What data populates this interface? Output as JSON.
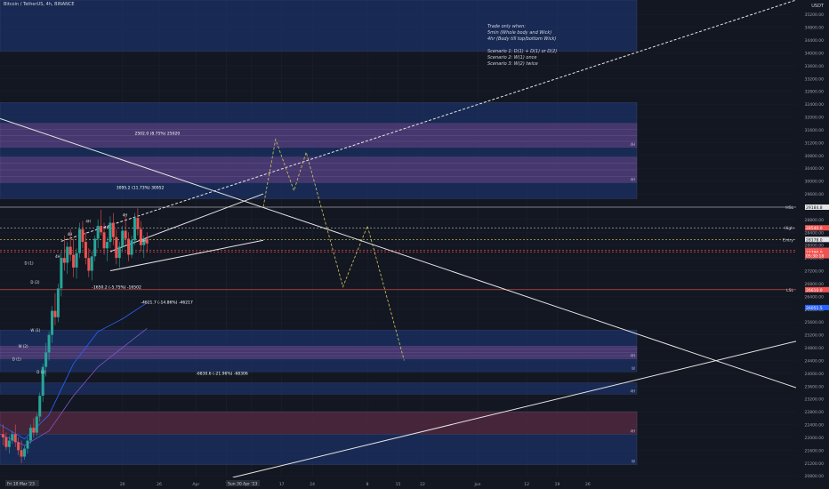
{
  "header": {
    "symbol_title": "Bitcoin / TetherUS, 4h, BINANCE"
  },
  "note": {
    "lines": [
      "Trade only when:",
      "5min (Whole body and Wick)",
      "4hr (Body till top/bottom Wick)",
      "",
      "Scenario 1: D(1) + D(1) or D(2)",
      "Scenario 2: W(1) once",
      "Scenario 3: W(2) twice"
    ]
  },
  "colors": {
    "background": "#131722",
    "zone_blue": "#1e3a7b",
    "zone_purple": "#5a3f7a",
    "zone_red": "#5a2330",
    "price_green": "#26a69a",
    "price_red": "#ef5350",
    "line_white": "#e6e6e6",
    "line_yellow": "#d4c85a",
    "ma_blue": "#2962ff"
  },
  "chart_data": {
    "type": "candlestick",
    "price_axis": {
      "currency": "USDT",
      "ticks": [
        35200,
        34800,
        34400,
        34000,
        33600,
        33200,
        32800,
        32400,
        32000,
        31600,
        31200,
        30800,
        30400,
        30000,
        29600,
        29200,
        28800,
        28400,
        28000,
        27600,
        27200,
        26800,
        26400,
        26000,
        25600,
        25200,
        24800,
        24400,
        24000,
        23600,
        23200,
        22800,
        22400,
        22000,
        21600,
        21200,
        20800
      ],
      "ylim": [
        20750,
        35650
      ]
    },
    "time_axis": {
      "labels": [
        {
          "x": 20,
          "label": "20"
        },
        {
          "x": 26,
          "label": "26"
        },
        {
          "x": 32,
          "label": "Apr"
        },
        {
          "x": 37,
          "label": "7"
        },
        {
          "x": 41,
          "label": "10"
        },
        {
          "x": 46,
          "label": "17"
        },
        {
          "x": 51,
          "label": "24"
        },
        {
          "x": 60,
          "label": "8"
        },
        {
          "x": 65,
          "label": "15"
        },
        {
          "x": 69,
          "label": "22"
        },
        {
          "x": 78,
          "label": "Jun"
        },
        {
          "x": 86,
          "label": "12"
        },
        {
          "x": 91,
          "label": "19"
        },
        {
          "x": 96,
          "label": "26"
        }
      ],
      "xlim": [
        0,
        130
      ],
      "range_badges": [
        "Fri 10 Mar '23",
        "Sun 30 Apr '23"
      ]
    },
    "zones": [
      {
        "x0": 0,
        "x1": 104,
        "y0": 34050,
        "y1": 35650,
        "kind": "blue",
        "label": ""
      },
      {
        "x0": 0,
        "x1": 104,
        "y0": 29450,
        "y1": 32450,
        "kind": "blue",
        "label": ""
      },
      {
        "x0": 0,
        "x1": 104,
        "y0": 31050,
        "y1": 31800,
        "kind": "purple",
        "label": "4H"
      },
      {
        "x0": 0,
        "x1": 104,
        "y0": 29950,
        "y1": 30750,
        "kind": "purple",
        "label": "4H"
      },
      {
        "x0": 0,
        "x1": 104,
        "y0": 24050,
        "y1": 25350,
        "kind": "blue",
        "label": "W"
      },
      {
        "x0": 0,
        "x1": 104,
        "y0": 24450,
        "y1": 24850,
        "kind": "purple",
        "label": "4H"
      },
      {
        "x0": 0,
        "x1": 104,
        "y0": 23350,
        "y1": 23700,
        "kind": "blue",
        "label": "4H"
      },
      {
        "x0": 0,
        "x1": 104,
        "y0": 21150,
        "y1": 22800,
        "kind": "blue",
        "label": "W"
      },
      {
        "x0": 0,
        "x1": 104,
        "y0": 22100,
        "y1": 22800,
        "kind": "red",
        "label": "4H"
      }
    ],
    "levels": [
      {
        "label": "HSL",
        "price": 29184.8,
        "price_text": "29184.8",
        "color": "#e6e6e6",
        "style": "solid"
      },
      {
        "label": "High",
        "price": 28540.0,
        "price_text": "28540.0",
        "color": "#e6e6e6",
        "style": "dashed"
      },
      {
        "label": "Entry",
        "price": 28178.0,
        "price_text": "28178.0",
        "color": "#d4c85a",
        "style": "dashed"
      },
      {
        "label": "",
        "price": 27838.0,
        "price_text": "27838.0",
        "color": "#ef5350",
        "style": "dashed"
      },
      {
        "label": "",
        "price": 27790.0,
        "price_text": "27790.0",
        "color": "#ef5350",
        "style": "dashed"
      },
      {
        "label": "LSL",
        "price": 26610.0,
        "price_text": "26610.0",
        "color": "#ef5350",
        "style": "solid"
      },
      {
        "label": "",
        "price": 26051.5,
        "price_text": "26051.5",
        "color": "#2962ff",
        "style": "none"
      }
    ],
    "countdown": "05:30:18",
    "measurements": [
      {
        "x": 22,
        "price": 31450,
        "text": "2502.0 (8.75%) 25020"
      },
      {
        "x": 19,
        "price": 29750,
        "text": "3095.2 (11.73%) 30952"
      },
      {
        "x": 15,
        "price": 26650,
        "text": "-1650.2 (-5.75%) -16502"
      },
      {
        "x": 23,
        "price": 26170,
        "text": "-4621.7 (-14.86%) -46217"
      },
      {
        "x": 32,
        "price": 23950,
        "text": "-6830.6 (-21.96%) -68306"
      }
    ],
    "pattern_labels": [
      "D (1)",
      "D (2)",
      "W (1)",
      "W (2)",
      "4H",
      "4H",
      "4H",
      "4H",
      "4H",
      "4H",
      "D (1)",
      "D (2)"
    ],
    "trendlines": [
      {
        "points": [
          [
            0,
            31950
          ],
          [
            130,
            23550
          ]
        ],
        "color": "#e6e6e6",
        "style": "solid"
      },
      {
        "points": [
          [
            38,
            20750
          ],
          [
            130,
            25000
          ]
        ],
        "color": "#e6e6e6",
        "style": "solid"
      },
      {
        "points": [
          [
            10,
            28120
          ],
          [
            130,
            35650
          ]
        ],
        "color": "#e6e6e6",
        "style": "dashed"
      },
      {
        "points": [
          [
            18,
            27800
          ],
          [
            43,
            29600
          ]
        ],
        "color": "#e6e6e6",
        "style": "solid"
      },
      {
        "points": [
          [
            18,
            27200
          ],
          [
            43,
            28150
          ]
        ],
        "color": "#e6e6e6",
        "style": "solid"
      }
    ],
    "projection_path": [
      [
        43,
        29200
      ],
      [
        45,
        31300
      ],
      [
        48,
        29700
      ],
      [
        50,
        30900
      ],
      [
        52,
        29500
      ],
      [
        56,
        26700
      ],
      [
        60,
        28600
      ],
      [
        66,
        24400
      ]
    ],
    "candles": [
      {
        "x": 0.5,
        "o": 22100,
        "h": 22400,
        "l": 21750,
        "c": 22000
      },
      {
        "x": 1,
        "o": 22000,
        "h": 22150,
        "l": 21600,
        "c": 21700
      },
      {
        "x": 1.5,
        "o": 21700,
        "h": 22050,
        "l": 21500,
        "c": 21900
      },
      {
        "x": 2,
        "o": 21900,
        "h": 22200,
        "l": 21800,
        "c": 22100
      },
      {
        "x": 2.5,
        "o": 22100,
        "h": 22400,
        "l": 21700,
        "c": 21850
      },
      {
        "x": 3,
        "o": 21850,
        "h": 22000,
        "l": 21450,
        "c": 21600
      },
      {
        "x": 3.5,
        "o": 21600,
        "h": 21900,
        "l": 21200,
        "c": 21400
      },
      {
        "x": 4,
        "o": 21400,
        "h": 21750,
        "l": 21300,
        "c": 21650
      },
      {
        "x": 4.5,
        "o": 21650,
        "h": 22000,
        "l": 21500,
        "c": 21900
      },
      {
        "x": 5,
        "o": 21900,
        "h": 22400,
        "l": 21800,
        "c": 22300
      },
      {
        "x": 5.5,
        "o": 22300,
        "h": 22600,
        "l": 22000,
        "c": 22150
      },
      {
        "x": 6,
        "o": 22150,
        "h": 22750,
        "l": 22050,
        "c": 22650
      },
      {
        "x": 6.5,
        "o": 22650,
        "h": 23400,
        "l": 22500,
        "c": 23300
      },
      {
        "x": 7,
        "o": 23300,
        "h": 24300,
        "l": 23100,
        "c": 24200
      },
      {
        "x": 7.5,
        "o": 24200,
        "h": 24950,
        "l": 23900,
        "c": 24650
      },
      {
        "x": 8,
        "o": 24650,
        "h": 25300,
        "l": 24400,
        "c": 25200
      },
      {
        "x": 8.5,
        "o": 25200,
        "h": 26100,
        "l": 24950,
        "c": 25950
      },
      {
        "x": 9,
        "o": 25950,
        "h": 26500,
        "l": 25500,
        "c": 25750
      },
      {
        "x": 9.5,
        "o": 25750,
        "h": 26800,
        "l": 25600,
        "c": 26650
      },
      {
        "x": 10,
        "o": 26650,
        "h": 27800,
        "l": 26400,
        "c": 27600
      },
      {
        "x": 10.5,
        "o": 27600,
        "h": 28300,
        "l": 27200,
        "c": 27450
      },
      {
        "x": 11,
        "o": 27450,
        "h": 28100,
        "l": 27100,
        "c": 27950
      },
      {
        "x": 11.5,
        "o": 27950,
        "h": 28500,
        "l": 27500,
        "c": 27700
      },
      {
        "x": 12,
        "o": 27700,
        "h": 28200,
        "l": 27000,
        "c": 27300
      },
      {
        "x": 12.5,
        "o": 27300,
        "h": 27900,
        "l": 26950,
        "c": 27750
      },
      {
        "x": 13,
        "o": 27750,
        "h": 28700,
        "l": 27600,
        "c": 28500
      },
      {
        "x": 13.5,
        "o": 28500,
        "h": 28750,
        "l": 27900,
        "c": 28100
      },
      {
        "x": 14,
        "o": 28100,
        "h": 28400,
        "l": 27400,
        "c": 27600
      },
      {
        "x": 14.5,
        "o": 27600,
        "h": 27900,
        "l": 27000,
        "c": 27200
      },
      {
        "x": 15,
        "o": 27200,
        "h": 27800,
        "l": 26900,
        "c": 27650
      },
      {
        "x": 15.5,
        "o": 27650,
        "h": 28300,
        "l": 27500,
        "c": 28200
      },
      {
        "x": 16,
        "o": 28200,
        "h": 28800,
        "l": 27900,
        "c": 28600
      },
      {
        "x": 16.5,
        "o": 28600,
        "h": 29100,
        "l": 28300,
        "c": 28400
      },
      {
        "x": 17,
        "o": 28400,
        "h": 28700,
        "l": 27700,
        "c": 27900
      },
      {
        "x": 17.5,
        "o": 27900,
        "h": 28250,
        "l": 27500,
        "c": 28100
      },
      {
        "x": 18,
        "o": 28100,
        "h": 28900,
        "l": 27900,
        "c": 28700
      },
      {
        "x": 18.5,
        "o": 28700,
        "h": 29000,
        "l": 28000,
        "c": 28250
      },
      {
        "x": 19,
        "o": 28250,
        "h": 28500,
        "l": 27400,
        "c": 27600
      },
      {
        "x": 19.5,
        "o": 27600,
        "h": 28100,
        "l": 27300,
        "c": 27950
      },
      {
        "x": 20,
        "o": 27950,
        "h": 28600,
        "l": 27800,
        "c": 28450
      },
      {
        "x": 20.5,
        "o": 28450,
        "h": 28900,
        "l": 28000,
        "c": 28200
      },
      {
        "x": 21,
        "o": 28200,
        "h": 28400,
        "l": 27500,
        "c": 27700
      },
      {
        "x": 21.5,
        "o": 27700,
        "h": 28300,
        "l": 27600,
        "c": 28150
      },
      {
        "x": 22,
        "o": 28150,
        "h": 29000,
        "l": 28000,
        "c": 28850
      },
      {
        "x": 22.5,
        "o": 28850,
        "h": 29150,
        "l": 28300,
        "c": 28500
      },
      {
        "x": 23,
        "o": 28500,
        "h": 28750,
        "l": 27800,
        "c": 28000
      },
      {
        "x": 23.5,
        "o": 28000,
        "h": 28300,
        "l": 27600,
        "c": 28200
      },
      {
        "x": 24,
        "o": 28200,
        "h": 28400,
        "l": 27800,
        "c": 28050
      }
    ],
    "moving_averages": [
      {
        "name": "",
        "color": "#2962ff",
        "points": [
          [
            0,
            22400
          ],
          [
            4,
            21950
          ],
          [
            8,
            22700
          ],
          [
            12,
            24300
          ],
          [
            16,
            25300
          ],
          [
            20,
            25700
          ],
          [
            24,
            26200
          ]
        ]
      },
      {
        "name": "",
        "color": "#7e57c2",
        "points": [
          [
            0,
            22100
          ],
          [
            4,
            21750
          ],
          [
            8,
            22200
          ],
          [
            12,
            23300
          ],
          [
            16,
            24200
          ],
          [
            20,
            24800
          ],
          [
            24,
            25400
          ]
        ]
      }
    ]
  }
}
